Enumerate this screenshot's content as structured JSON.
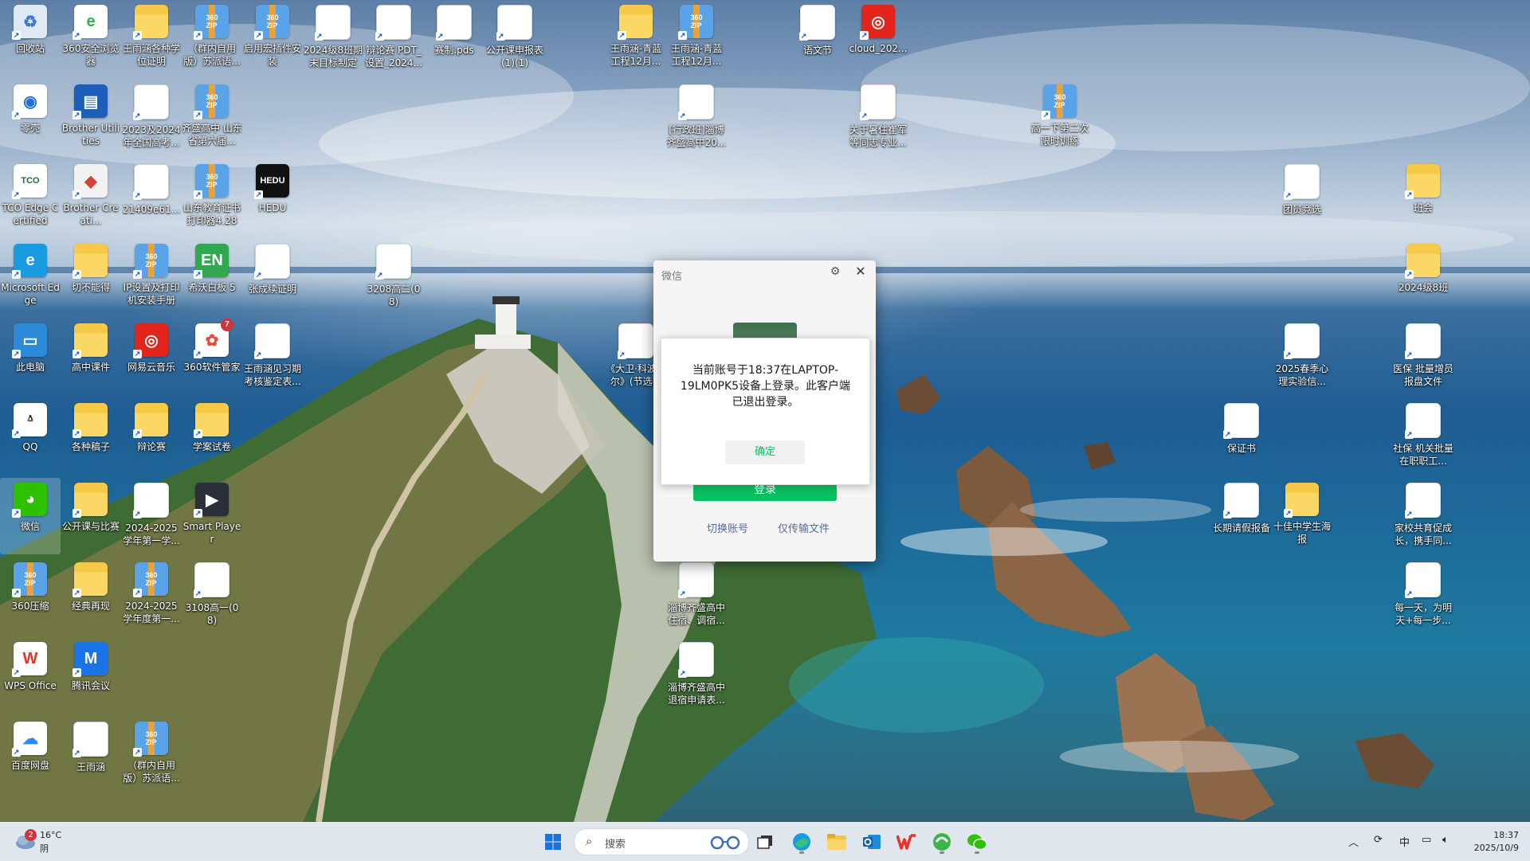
{
  "desktop": {
    "icons": [
      {
        "label": "回收站",
        "icon": "recycle-bin-icon"
      },
      {
        "label": "360安全浏览器",
        "icon": "browser-360-icon"
      },
      {
        "label": "王雨涵各种学位证明",
        "icon": "folder-icon"
      },
      {
        "label": "（群内自用版）苏派语...",
        "icon": "zip-archive-icon"
      },
      {
        "label": "启用宏插件安装",
        "icon": "zip-archive-icon"
      },
      {
        "label": "2024级8班期末目标制定",
        "icon": "word-doc-icon"
      },
      {
        "label": "辩论赛 PDT_设置_2024...",
        "icon": "blank-file-icon"
      },
      {
        "label": "赛制.pds",
        "icon": "blank-file-icon"
      },
      {
        "label": "公开课申报表(1)(1)",
        "icon": "word-doc-icon"
      },
      {
        "label": "王雨涵-青蓝工程12月...",
        "icon": "folder-icon"
      },
      {
        "label": "王雨涵-青蓝工程12月...",
        "icon": "zip-archive-icon"
      },
      {
        "label": "语文节",
        "icon": "ppt-icon"
      },
      {
        "label": "cloud_202...",
        "icon": "netease-music-icon"
      },
      {
        "label": "零壳",
        "icon": "app-circle-icon"
      },
      {
        "label": "Brother Utilities",
        "icon": "brother-utilities-icon"
      },
      {
        "label": "2023及2024年全国高考...",
        "icon": "word-doc-icon"
      },
      {
        "label": "齐盛高中 山东省第六届...",
        "icon": "zip-archive-icon"
      },
      {
        "label": "[行政班]淄博齐盛高中20...",
        "icon": "sheet-icon"
      },
      {
        "label": "关于暑住崔军等同志专业...",
        "icon": "pdf-icon"
      },
      {
        "label": "高一下第二次限时训练",
        "icon": "zip-archive-icon"
      },
      {
        "label": "TCO Edge Certified",
        "icon": "tco-edge-icon"
      },
      {
        "label": "Brother Creati...",
        "icon": "brother-creative-icon"
      },
      {
        "label": "21409e61...",
        "icon": "blank-file-icon"
      },
      {
        "label": "山东教育证书打印器4.28",
        "icon": "zip-archive-icon"
      },
      {
        "label": "HEDU",
        "icon": "hedu-icon"
      },
      {
        "label": "团员竞选",
        "icon": "sheet-icon"
      },
      {
        "label": "班会",
        "icon": "folder-icon"
      },
      {
        "label": "Microsoft Edge",
        "icon": "edge-icon"
      },
      {
        "label": "切不能得",
        "icon": "folder-icon"
      },
      {
        "label": "IP设置及打印机安装手册",
        "icon": "zip-archive-icon"
      },
      {
        "label": "希沃白板 5",
        "icon": "seewo-icon"
      },
      {
        "label": "张成续证明",
        "icon": "word-doc-icon"
      },
      {
        "label": "3208高二(08)",
        "icon": "sheet-icon"
      },
      {
        "label": "2024级8班",
        "icon": "folder-icon"
      },
      {
        "label": "此电脑",
        "icon": "this-pc-icon"
      },
      {
        "label": "高中课件",
        "icon": "folder-icon"
      },
      {
        "label": "网易云音乐",
        "icon": "netease-music-icon"
      },
      {
        "label": "360软件管家",
        "icon": "app-360-manager-icon"
      },
      {
        "label": "王雨涵见习期考核鉴定表...",
        "icon": "word-doc-icon"
      },
      {
        "label": "《大卫·科波菲尔》(节选...",
        "icon": "ppt-icon"
      },
      {
        "label": "2025春季心理实验信...",
        "icon": "sheet-icon"
      },
      {
        "label": "医保 批量增员报盘文件",
        "icon": "sheet-icon"
      },
      {
        "label": "QQ",
        "icon": "qq-icon"
      },
      {
        "label": "各种稿子",
        "icon": "folder-icon"
      },
      {
        "label": "辩论赛",
        "icon": "folder-icon"
      },
      {
        "label": "学案试卷",
        "icon": "folder-icon"
      },
      {
        "label": "保证书",
        "icon": "word-doc-icon"
      },
      {
        "label": "社保 机关批量在职职工...",
        "icon": "sheet-icon"
      },
      {
        "label": "微信",
        "icon": "wechat-icon"
      },
      {
        "label": "公开课与比赛",
        "icon": "folder-icon"
      },
      {
        "label": "2024-2025学年第一学...",
        "icon": "sheet-icon"
      },
      {
        "label": "Smart Player",
        "icon": "smart-player-icon"
      },
      {
        "label": "长期请假报备",
        "icon": "word-doc-icon"
      },
      {
        "label": "十佳中学生海报",
        "icon": "folder-icon"
      },
      {
        "label": "家校共育促成长，携手同...",
        "icon": "ppt-icon"
      },
      {
        "label": "360压缩",
        "icon": "zip-archive-icon"
      },
      {
        "label": "经典再现",
        "icon": "folder-icon"
      },
      {
        "label": "2024-2025学年度第一...",
        "icon": "zip-archive-icon"
      },
      {
        "label": "3108高一(08)",
        "icon": "sheet-icon"
      },
      {
        "label": "淄博齐盛高中住宿、调宿...",
        "icon": "sheet-icon"
      },
      {
        "label": "每一天，为明天+每一步...",
        "icon": "ppt-icon"
      },
      {
        "label": "WPS Office",
        "icon": "wps-icon"
      },
      {
        "label": "腾讯会议",
        "icon": "tencent-meeting-icon"
      },
      {
        "label": "淄博齐盛高中退宿申请表...",
        "icon": "word-doc-icon"
      },
      {
        "label": "百度网盘",
        "icon": "baidu-netdisk-icon"
      },
      {
        "label": "王雨涵",
        "icon": "word-doc-icon"
      },
      {
        "label": "（群内自用版）苏派语...",
        "icon": "zip-archive-icon"
      }
    ]
  },
  "wechat": {
    "title": "微信",
    "login_button": "登录",
    "switch_account": "切换账号",
    "transfer_only": "仅传输文件",
    "notice": {
      "message": "当前账号于18:37在LAPTOP-19LM0PK5设备上登录。此客户端已退出登录。",
      "ok_button": "确定"
    }
  },
  "taskbar": {
    "weather": {
      "temp": "16°C",
      "condition": "阴",
      "badge": "2"
    },
    "search_placeholder": "搜索",
    "apps": [
      "start-icon",
      "search-icon",
      "task-view-icon",
      "edge-icon",
      "file-explorer-icon",
      "outlook-icon",
      "wps-icon",
      "browser-360-icon",
      "wechat-icon"
    ],
    "tray": {
      "ime": "中"
    },
    "clock": {
      "time": "18:37",
      "date": "2025/10/9"
    }
  },
  "badges": {
    "app_360_manager": "7"
  },
  "colors": {
    "wechat_green": "#07c160",
    "link_blue": "#576b95",
    "badge_red": "#d13438"
  }
}
